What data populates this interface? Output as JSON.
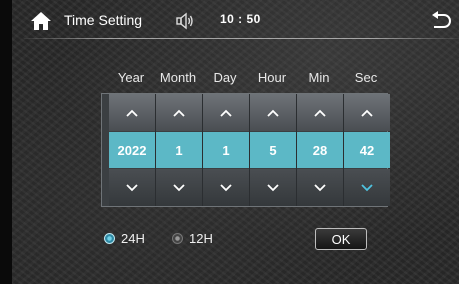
{
  "header": {
    "title": "Time Setting",
    "clock": "10 : 50",
    "home_icon": "home-icon",
    "speaker_icon": "speaker-icon",
    "back_icon": "back-arrow-icon"
  },
  "picker": {
    "columns": [
      {
        "label": "Year",
        "value": "2022"
      },
      {
        "label": "Month",
        "value": "1"
      },
      {
        "label": "Day",
        "value": "1"
      },
      {
        "label": "Hour",
        "value": "5"
      },
      {
        "label": "Min",
        "value": "28"
      },
      {
        "label": "Sec",
        "value": "42"
      }
    ],
    "active_down_column": "Sec"
  },
  "format": {
    "options": [
      {
        "label": "24H",
        "selected": true
      },
      {
        "label": "12H",
        "selected": false
      }
    ]
  },
  "actions": {
    "ok_label": "OK"
  },
  "colors": {
    "accent": "#5cb8c6",
    "background": "#2a2a2a",
    "highlight_chevron": "#4fc3e0"
  }
}
